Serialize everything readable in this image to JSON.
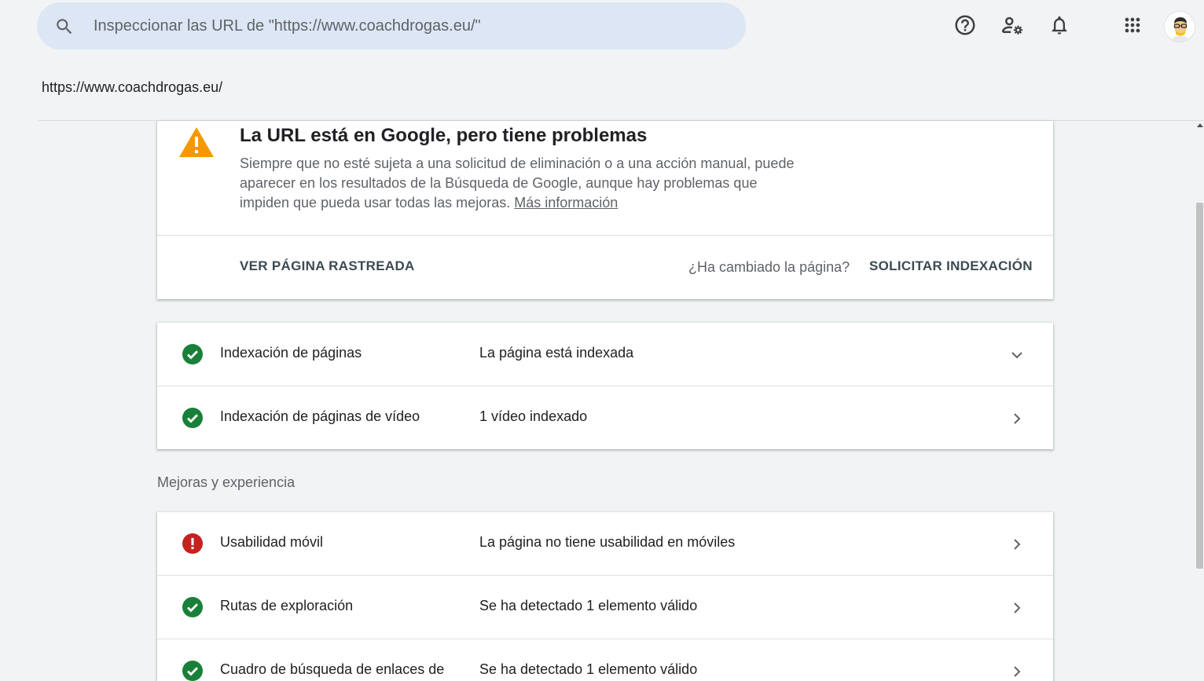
{
  "search": {
    "placeholder": "Inspeccionar las URL de \"https://www.coachdrogas.eu/\""
  },
  "property_url": "https://www.coachdrogas.eu/",
  "colors": {
    "green": "#188038",
    "red": "#c5221f",
    "orange": "#f29900",
    "search_bg": "#dde6f4"
  },
  "status": {
    "title": "La URL está en Google, pero tiene problemas",
    "description": "Siempre que no esté sujeta a una solicitud de eliminación o a una acción manual, puede aparecer en los resultados de la Búsqueda de Google, aunque hay problemas que impiden que pueda usar todas las mejoras.",
    "more_link": "Más información",
    "view_crawled": "VER PÁGINA RASTREADA",
    "changed_question": "¿Ha cambiado la página?",
    "request_indexing": "SOLICITAR INDEXACIÓN"
  },
  "indexing": [
    {
      "label": "Indexación de páginas",
      "value": "La página está indexada",
      "status": "ok",
      "chevron": "down"
    },
    {
      "label": "Indexación de páginas de vídeo",
      "value": "1 vídeo indexado",
      "status": "ok",
      "chevron": "right"
    }
  ],
  "enhancements_title": "Mejoras y experiencia",
  "enhancements": [
    {
      "label": "Usabilidad móvil",
      "value": "La página no tiene usabilidad en móviles",
      "status": "error",
      "chevron": "right"
    },
    {
      "label": "Rutas de exploración",
      "value": "Se ha detectado 1 elemento válido",
      "status": "ok",
      "chevron": "right"
    },
    {
      "label": "Cuadro de búsqueda de enlaces de",
      "value": "Se ha detectado 1 elemento válido",
      "status": "ok",
      "chevron": "right"
    }
  ]
}
